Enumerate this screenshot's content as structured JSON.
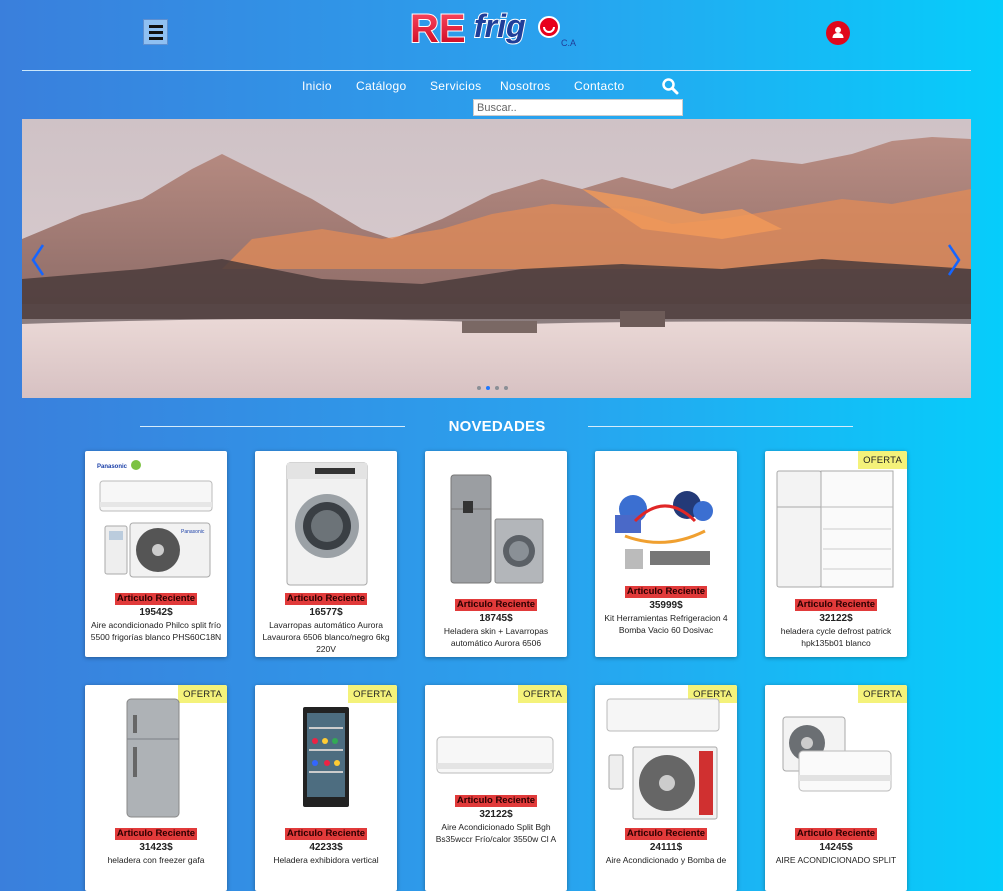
{
  "header": {
    "logo_text": "REfrigo",
    "logo_suffix": "C.A",
    "menu_icon": "hamburger-menu-icon",
    "user_icon": "user-account-icon"
  },
  "nav": {
    "items": [
      "Inicio",
      "Catálogo",
      "Servicios",
      "Nosotros",
      "Contacto"
    ],
    "search_icon": "search-icon",
    "search_placeholder": "Buscar.."
  },
  "hero": {
    "slide_count": 4,
    "active_slide": 2,
    "prev_icon": "chevron-left-icon",
    "next_icon": "chevron-right-icon"
  },
  "section": {
    "title": "NOVEDADES"
  },
  "products": [
    {
      "oferta": "",
      "badge": "Articulo Reciente",
      "price": "19542$",
      "name": "Aire acondicionado Philco split frío 5500 frigorías blanco PHS60C18N",
      "image": "split-ac"
    },
    {
      "oferta": "",
      "badge": "Articulo Reciente",
      "price": "16577$",
      "name": "Lavarropas automático Aurora Lavaurora 6506 blanco/negro 6kg 220V",
      "image": "washing-machine"
    },
    {
      "oferta": "",
      "badge": "Articulo Reciente",
      "price": "18745$",
      "name": "Heladera skin + Lavarropas automático Aurora 6506",
      "image": "fridge-washer-combo"
    },
    {
      "oferta": "",
      "badge": "Articulo Reciente",
      "price": "35999$",
      "name": "Kit Herramientas Refrigeracion 4 Bomba Vacio 60 Dosivac",
      "image": "refrigeration-tool-kit"
    },
    {
      "oferta": "OFERTA",
      "badge": "Articulo Reciente",
      "price": "32122$",
      "name": "heladera cycle defrost patrick hpk135b01 blanco",
      "image": "open-white-fridge"
    },
    {
      "oferta": "OFERTA",
      "badge": "Articulo Reciente",
      "price": "31423$",
      "name": "heladera con freezer gafa",
      "image": "silver-fridge"
    },
    {
      "oferta": "OFERTA",
      "badge": "Articulo Reciente",
      "price": "42233$",
      "name": "Heladera exhibidora vertical",
      "image": "display-cooler"
    },
    {
      "oferta": "OFERTA",
      "badge": "Articulo Reciente",
      "price": "32122$",
      "name": "Aire Acondicionado Split Bgh Bs35wccr Frío/calor 3550w Cl A",
      "image": "split-indoor-unit"
    },
    {
      "oferta": "OFERTA",
      "badge": "Articulo Reciente",
      "price": "24111$",
      "name": "Aire Acondicionado y Bomba de",
      "image": "split-ac-olmo"
    },
    {
      "oferta": "OFERTA",
      "badge": "Articulo Reciente",
      "price": "14245$",
      "name": "AIRE ACONDICIONADO SPLIT",
      "image": "split-ac-small"
    }
  ],
  "colors": {
    "accent_red": "#e13a3a",
    "oferta_yellow": "#f4f27a",
    "active_dot": "#1e78ff"
  }
}
